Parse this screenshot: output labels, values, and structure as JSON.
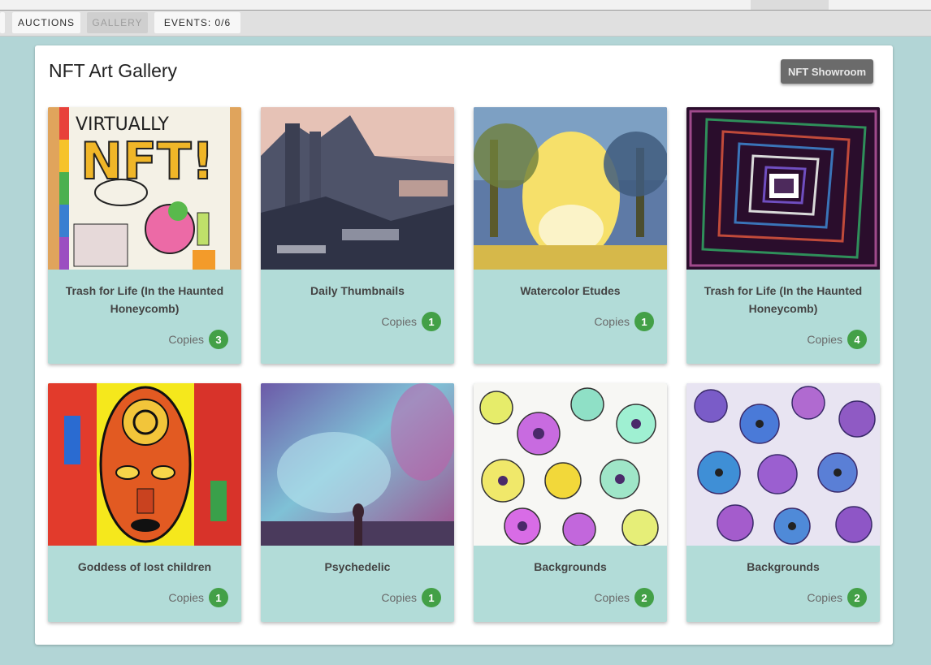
{
  "nav": {
    "tabs": [
      {
        "label": "AUCTIONS"
      },
      {
        "label": "GALLERY"
      },
      {
        "label": "EVENTS: 0/6"
      }
    ]
  },
  "gallery": {
    "title": "NFT Art Gallery",
    "showroom_label": "NFT Showroom",
    "copies_label": "Copies",
    "cards": [
      {
        "title": "Trash for Life (In the Haunted Honeycomb)",
        "copies": "3"
      },
      {
        "title": "Daily Thumbnails",
        "copies": "1"
      },
      {
        "title": "Watercolor Etudes",
        "copies": "1"
      },
      {
        "title": "Trash for Life (In the Haunted Honeycomb)",
        "copies": "4"
      },
      {
        "title": "Goddess of lost children",
        "copies": "1"
      },
      {
        "title": "Psychedelic",
        "copies": "1"
      },
      {
        "title": "Backgrounds",
        "copies": "2"
      },
      {
        "title": "Backgrounds",
        "copies": "2"
      }
    ]
  },
  "colors": {
    "background": "#b2d5d6",
    "card": "#b2dcd8",
    "badge": "#43a047",
    "showroom_button": "#6b6b6b"
  }
}
